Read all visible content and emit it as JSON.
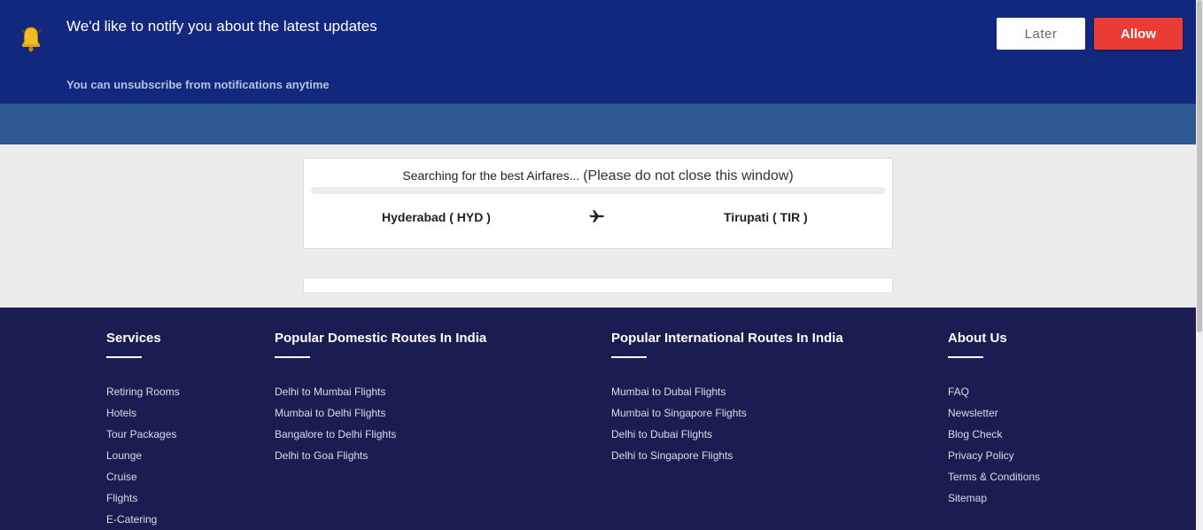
{
  "notification": {
    "title": "We'd like to notify you about the latest updates",
    "subtitle": "You can unsubscribe from notifications anytime",
    "later_label": "Later",
    "allow_label": "Allow"
  },
  "search": {
    "status_text": "Searching for the best Airfares...",
    "status_note": "(Please do not close this window)",
    "progress": 0,
    "origin": "Hyderabad ( HYD )",
    "destination": "Tirupati ( TIR )"
  },
  "footer": {
    "columns": [
      {
        "title": "Services",
        "links": [
          "Retiring Rooms",
          "Hotels",
          "Tour Packages",
          "Lounge",
          "Cruise",
          "Flights",
          "E-Catering"
        ]
      },
      {
        "title": "Popular Domestic Routes In India",
        "links": [
          "Delhi to Mumbai Flights",
          "Mumbai to Delhi Flights",
          "Bangalore to Delhi Flights",
          "Delhi to Goa Flights"
        ]
      },
      {
        "title": "Popular International Routes In India",
        "links": [
          "Mumbai to Dubai Flights",
          "Mumbai to Singapore Flights",
          "Delhi to Dubai Flights",
          "Delhi to Singapore Flights"
        ]
      },
      {
        "title": "About Us",
        "links": [
          "FAQ",
          "Newsletter",
          "Blog Check",
          "Privacy Policy",
          "Terms & Conditions",
          "Sitemap"
        ]
      }
    ]
  },
  "icons": {
    "bell": "bell-icon",
    "plane": "airplane-icon"
  },
  "colors": {
    "notify_bg": "#12287f",
    "allow": "#ea3b35",
    "header_band": "#2d5a92",
    "footer_bg": "#1b1d52"
  }
}
